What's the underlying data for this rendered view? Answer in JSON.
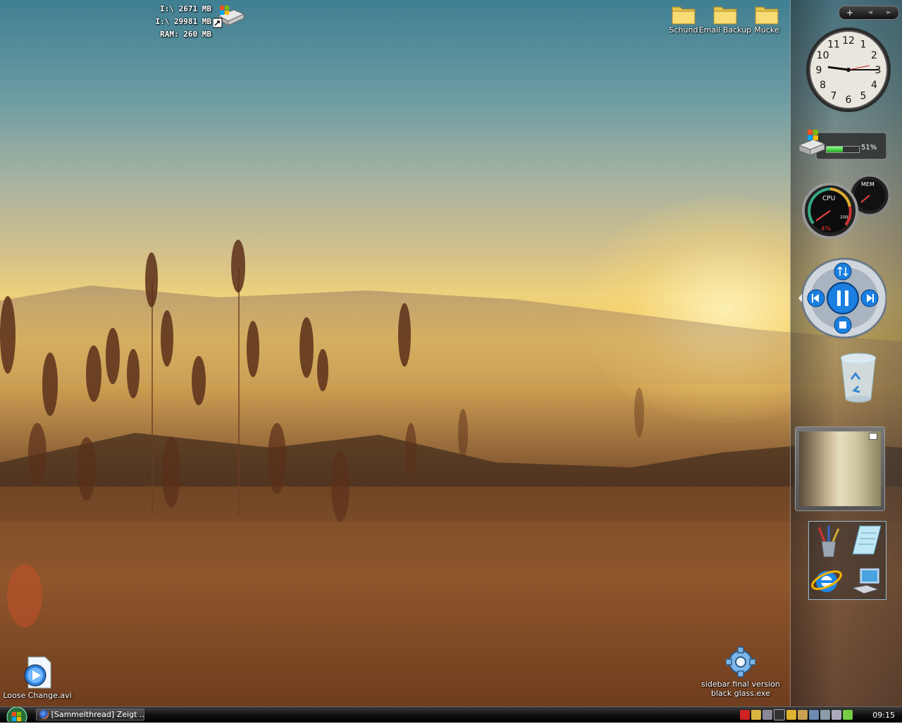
{
  "drive_info": {
    "line1": "I:\\ 2671 MB",
    "line2": "I:\\ 29981 MB",
    "line3": "RAM: 260 MB"
  },
  "desktop_icons": {
    "schund": "Schund",
    "email_backup": "Email Backup",
    "mucke": "Mucke",
    "loose_change": "Loose Change.avi",
    "sidebar_exe": "sidebar final version black glass.exe"
  },
  "sidebar": {
    "controls": {
      "add": "+",
      "prev": "◄",
      "next": "►"
    },
    "clock": {
      "numbers": [
        "12",
        "1",
        "2",
        "3",
        "4",
        "5",
        "6",
        "7",
        "8",
        "9",
        "10",
        "11"
      ],
      "hour": 9,
      "minute": 15
    },
    "disk": {
      "percent_label": "51%",
      "fill_fraction": 0.51
    },
    "cpu": {
      "cpu_label": "CPU",
      "cpu_value": "4%",
      "mem_label": "MEM",
      "scale_label": "100"
    }
  },
  "taskbar": {
    "task_label": "[Sammelthread] Zeigt ...",
    "time": "09:15"
  },
  "colors": {
    "accent": "#2a8fdc",
    "taskbar": "#111111"
  }
}
